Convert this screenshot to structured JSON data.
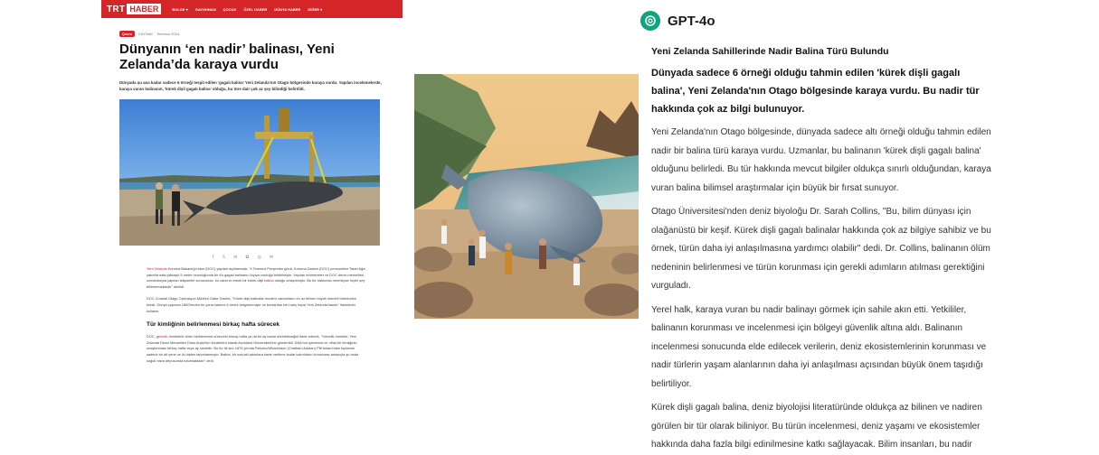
{
  "trt": {
    "logo_trt": "TRT",
    "logo_haber": "HABER",
    "nav": [
      "BOLGE ▾",
      "GAYGHNAN",
      "ÇOCUK",
      "ÖZEL HABER",
      "DÜNYA HABER",
      "DİĞER ▾"
    ],
    "tag": "Çevre",
    "meta_source": "KAYNAK",
    "meta_date": "Temmuz 2024",
    "title": "Dünyanın ‘en nadir’ balinası, Yeni Zelanda’da karaya vurdu",
    "lead": "Dünyada şu ana kadar sadece 6 örneği tespit edilen 'gagalı balina' Yeni Zelanda'nın Otago bölgesinde karaya vurdu. Yapılan incelemelerde, karaya vuran balinanın, 'kürek dişli gagalı balina' olduğu, bu türe dair çok az şey bilindiği belirtildi.",
    "share_icons": [
      "f",
      "𝕏",
      "in",
      "✿",
      "◎",
      "✉"
    ],
    "para1_link": "Yeni Zelanda",
    "para1_text": " Koruma Bakanlığı'ndan (DOC) yapılan açıklamada, \"4 Temmuz Perşembe günü, Koruma Dairesi (DOC) personeline Taiari Ağzı yakınlarında yaklaşık 5 metre uzunluğunda bir tür gagalı balinanın kıyıya vurduğu bildirilmiştir. Yapılan incelemeler ve DOC deniz memelileri uzmanlarıyla yapılan istişareler sonucunda, bu canlının erkek bir kürek dişli ",
    "para1_link2": "balina",
    "para1_text2": " olduğu anlaşılmıştır. Bu tür hakkında neredeyse hiçbir şey bilinmemektedir\" denildi.",
    "para2": "DOC Coastal Otago Operasyon Müdürü Gabe Davies, \"Kürek dişli balinalar modern zamanların en az bilinen büyük memeli türlerinden biridir. Dünya çapında 1800'lerden bu yana sadece 6 örnek belgelenmiştir ve bunlardan biri hariç hepsi Yeni Zelanda'dandır\" ifadelerini kullandı.",
    "subhead": "Tür kimliğinin belirlenmesi birkaç hafta sürecek",
    "para3_a": "DOC, ",
    "para3_link": "genetik",
    "para3_b": " örneklerle türün belirlenmesi sürecinin birkaç hafta ya da bir ay kadar süreblleceğini ifade ederek, \"Genetik örnekler, Yeni Zelanda Deniz Memelileri Doku Arşivi'nin küratörleri olarak Auckland Üniversitesi'ne gönderildi. DNA'nın işlenmesi ve nihai tür kimliğinin onaylanması birkaç hafta veya ay sürebilir. Bu tür ilk kez 1874 yılında Rekohu/Wharekauri (Chatham Adaları) Pitt Adası'ndan toplanan sadece bir alt çene ve iki dişten tanımlanmıştır. Balina, bir sonraki adımlara karar verilene kadar kalıntıların korunması amacıyla şu anda soğuk hava deposunda tutulmaktadır\" dedi."
  },
  "gpt": {
    "name": "GPT-4o",
    "heading": "Yeni Zelanda Sahillerinde Nadir Balina Türü Bulundu",
    "lead": "Dünyada sadece 6 örneği olduğu tahmin edilen 'kürek dişli gagalı balina', Yeni Zelanda'nın Otago bölgesinde karaya vurdu. Bu nadir tür hakkında çok az bilgi bulunuyor.",
    "paragraphs": [
      "Yeni Zelanda'nın Otago bölgesinde, dünyada sadece altı örneği olduğu tahmin edilen nadir bir balina türü karaya vurdu. Uzmanlar, bu balinanın 'kürek dişli gagalı balina' olduğunu belirledi. Bu tür hakkında mevcut bilgiler oldukça sınırlı olduğundan, karaya vuran balina bilimsel araştırmalar için büyük bir fırsat sunuyor.",
      "Otago Üniversitesi'nden deniz biyoloğu Dr. Sarah Collins, \"Bu, bilim dünyası için olağanüstü bir keşif. Kürek dişli gagalı balinalar hakkında çok az bilgiye sahibiz ve bu örnek, türün daha iyi anlaşılmasına yardımcı olabilir\" dedi. Dr. Collins, balinanın ölüm nedeninin belirlenmesi ve türün korunması için gerekli adımların atılması gerektiğini vurguladı.",
      "Yerel halk, karaya vuran bu nadir balinayı görmek için sahile akın etti. Yetkililer, balinanın korunması ve incelenmesi için bölgeyi güvenlik altına aldı. Balinanın incelenmesi sonucunda elde edilecek verilerin, deniz ekosistemlerinin korunması ve nadir türlerin yaşam alanlarının daha iyi anlaşılması açısından büyük önem taşıdığı belirtiliyor.",
      "Kürek dişli gagalı balina, deniz biyolojisi literatüründe oldukça az bilinen ve nadiren görülen bir tür olarak biliniyor. Bu türün incelenmesi, deniz yaşamı ve ekosistemler hakkında daha fazla bilgi edinilmesine katkı sağlayacak. Bilim insanları, bu nadir olayın, deniz biyolojisi alanında yeni araştırmalara kapı aralayacağını umuyor."
    ]
  },
  "colors": {
    "trt_red": "#d42529",
    "gpt_green": "#10a37f"
  },
  "icons": [
    "openai-logo-icon",
    "facebook-icon",
    "x-icon",
    "linkedin-icon",
    "pinterest-icon",
    "whatsapp-icon",
    "mail-icon"
  ]
}
